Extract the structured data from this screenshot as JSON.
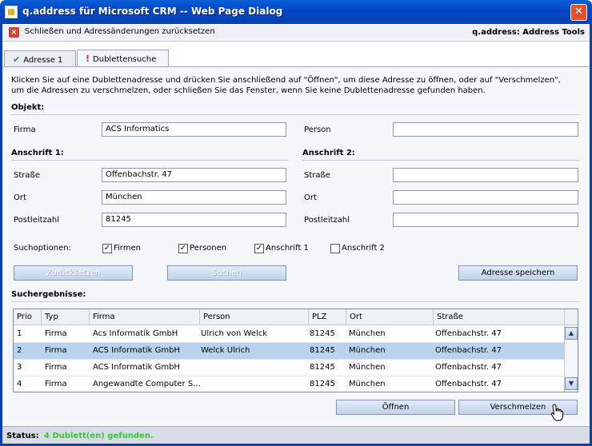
{
  "window": {
    "title": "q.address für Microsoft CRM -- Web Page Dialog",
    "close_glyph": "✕"
  },
  "toolbar": {
    "reset_label": "Schließen und Adressänderungen zurücksetzen",
    "brand": "q.address: Address Tools"
  },
  "tabs": [
    {
      "label": "Adresse 1",
      "icon": "check-icon"
    },
    {
      "label": "Dublettensuche",
      "icon": "exclamation-icon"
    }
  ],
  "instructions": "Klicken Sie auf eine Dublettenadresse und drücken Sie anschließend auf \"Öffnen\", um diese Adresse zu öffnen, oder auf \"Verschmelzen\", um die Adressen zu verschmelzen, oder schließen Sie das Fenster, wenn Sie keine Dublettenadresse gefunden haben.",
  "object": {
    "header": "Objekt:",
    "firma_label": "Firma",
    "firma_value": "ACS Informatics",
    "person_label": "Person",
    "person_value": ""
  },
  "address1": {
    "header": "Anschrift 1:",
    "street_label": "Straße",
    "street_value": "Offenbachstr. 47",
    "city_label": "Ort",
    "city_value": "München",
    "zip_label": "Postleitzahl",
    "zip_value": "81245"
  },
  "address2": {
    "header": "Anschrift 2:",
    "street_label": "Straße",
    "street_value": "",
    "city_label": "Ort",
    "city_value": "",
    "zip_label": "Postleitzahl",
    "zip_value": ""
  },
  "search_options": {
    "label": "Suchoptionen:",
    "options": [
      {
        "label": "Firmen",
        "checked": true
      },
      {
        "label": "Personen",
        "checked": true
      },
      {
        "label": "Anschrift 1",
        "checked": true
      },
      {
        "label": "Anschrift 2",
        "checked": false
      }
    ],
    "check_glyph": "✓"
  },
  "buttons": {
    "reset": "Zurücksetzen",
    "search": "Suchen",
    "save": "Adresse speichern",
    "open": "Öffnen",
    "merge": "Verschmelzen"
  },
  "results": {
    "header": "Suchergebnisse:",
    "columns": [
      "Prio",
      "Typ",
      "Firma",
      "Person",
      "PLZ",
      "Ort",
      "Straße"
    ],
    "rows": [
      [
        "1",
        "Firma",
        "Acs Informatik GmbH",
        "Ulrich von Welck",
        "81245",
        "München",
        "Offenbachstr. 47"
      ],
      [
        "2",
        "Firma",
        "ACS Informatik GmbH",
        "Welck Ulrich",
        "81245",
        "München",
        "Offenbachstr. 47"
      ],
      [
        "3",
        "Firma",
        "ACS Informatik GmbH",
        "",
        "81245",
        "München",
        "Offenbachstr. 47"
      ],
      [
        "4",
        "Firma",
        "Angewandte Computer S...",
        "",
        "81245",
        "München",
        "Offenbachstr. 47"
      ]
    ],
    "selected_row": 2,
    "scroll_up": "▲",
    "scroll_down": "▼"
  },
  "status": {
    "label": "Status:",
    "value": "4 Dublett(en) gefunden."
  }
}
